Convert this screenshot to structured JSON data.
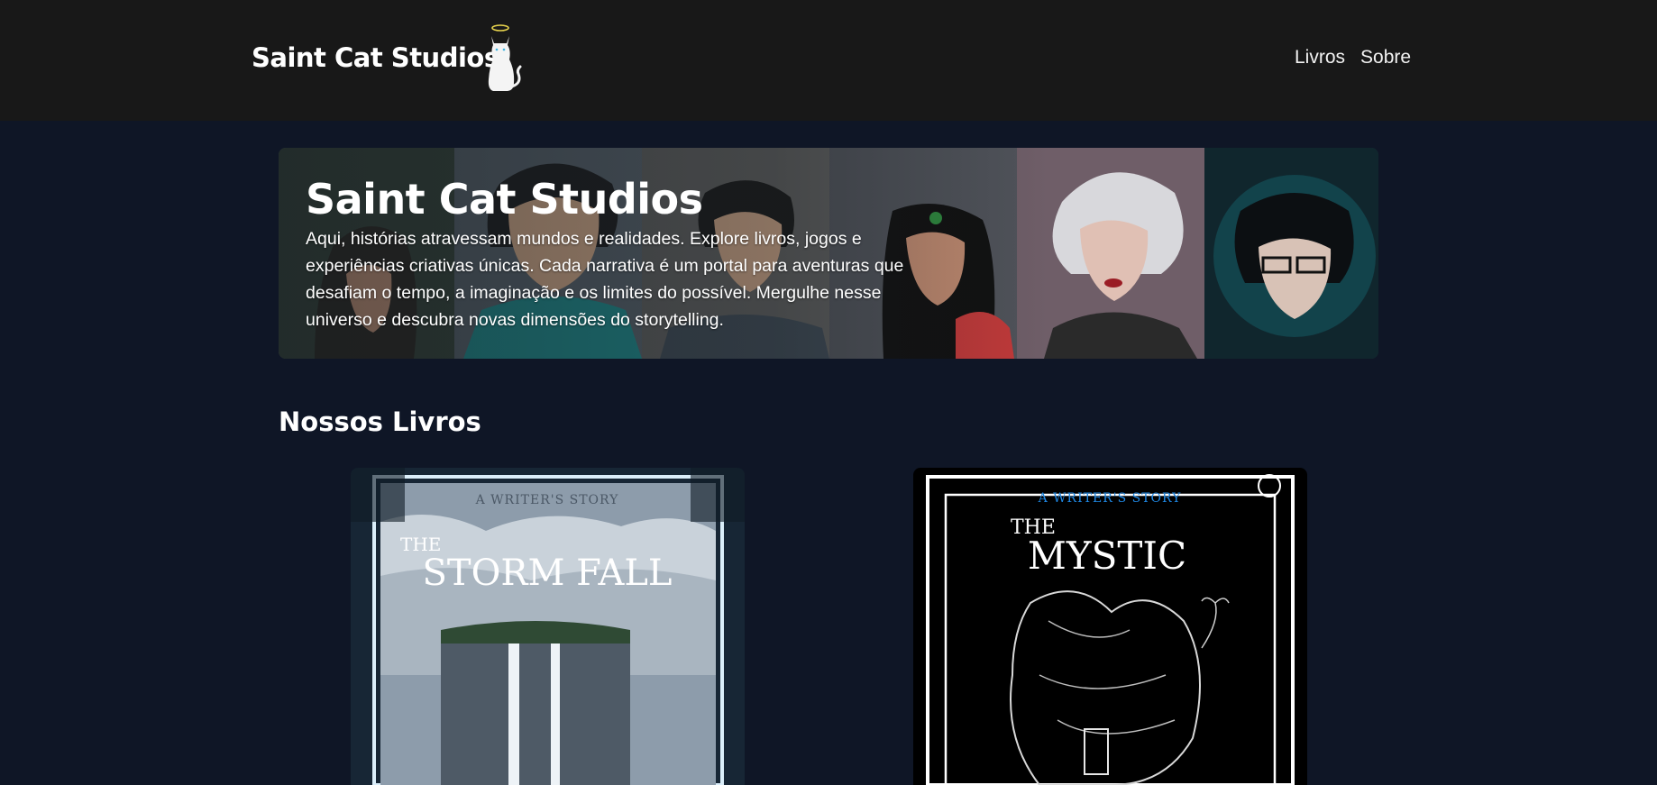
{
  "header": {
    "brand": "Saint Cat Studios",
    "logo_icon": "halo-cat-icon",
    "nav": [
      "Livros",
      "Sobre"
    ]
  },
  "hero": {
    "title": "Saint Cat Studios",
    "description": "Aqui, histórias atravessam mundos e realidades. Explore livros, jogos e experiências criativas únicas. Cada narrativa é um portal para aventuras que desafiam o tempo, a imaginação e os limites do possível. Mergulhe nesse universo e descubra novas dimensões do storytelling."
  },
  "books_section": {
    "title": "Nossos Livros",
    "books": [
      {
        "tagline": "A WRITER'S STORY",
        "title_prefix": "THE",
        "title_main": "STORM FALL",
        "accent": "#dbeefa"
      },
      {
        "tagline": "A WRITER'S STORY",
        "title_prefix": "THE",
        "title_main": "MYSTIC",
        "accent": "#1e88e5"
      }
    ]
  },
  "colors": {
    "page_bg": "#0f1626",
    "header_bg": "#181818",
    "text": "#ffffff"
  }
}
